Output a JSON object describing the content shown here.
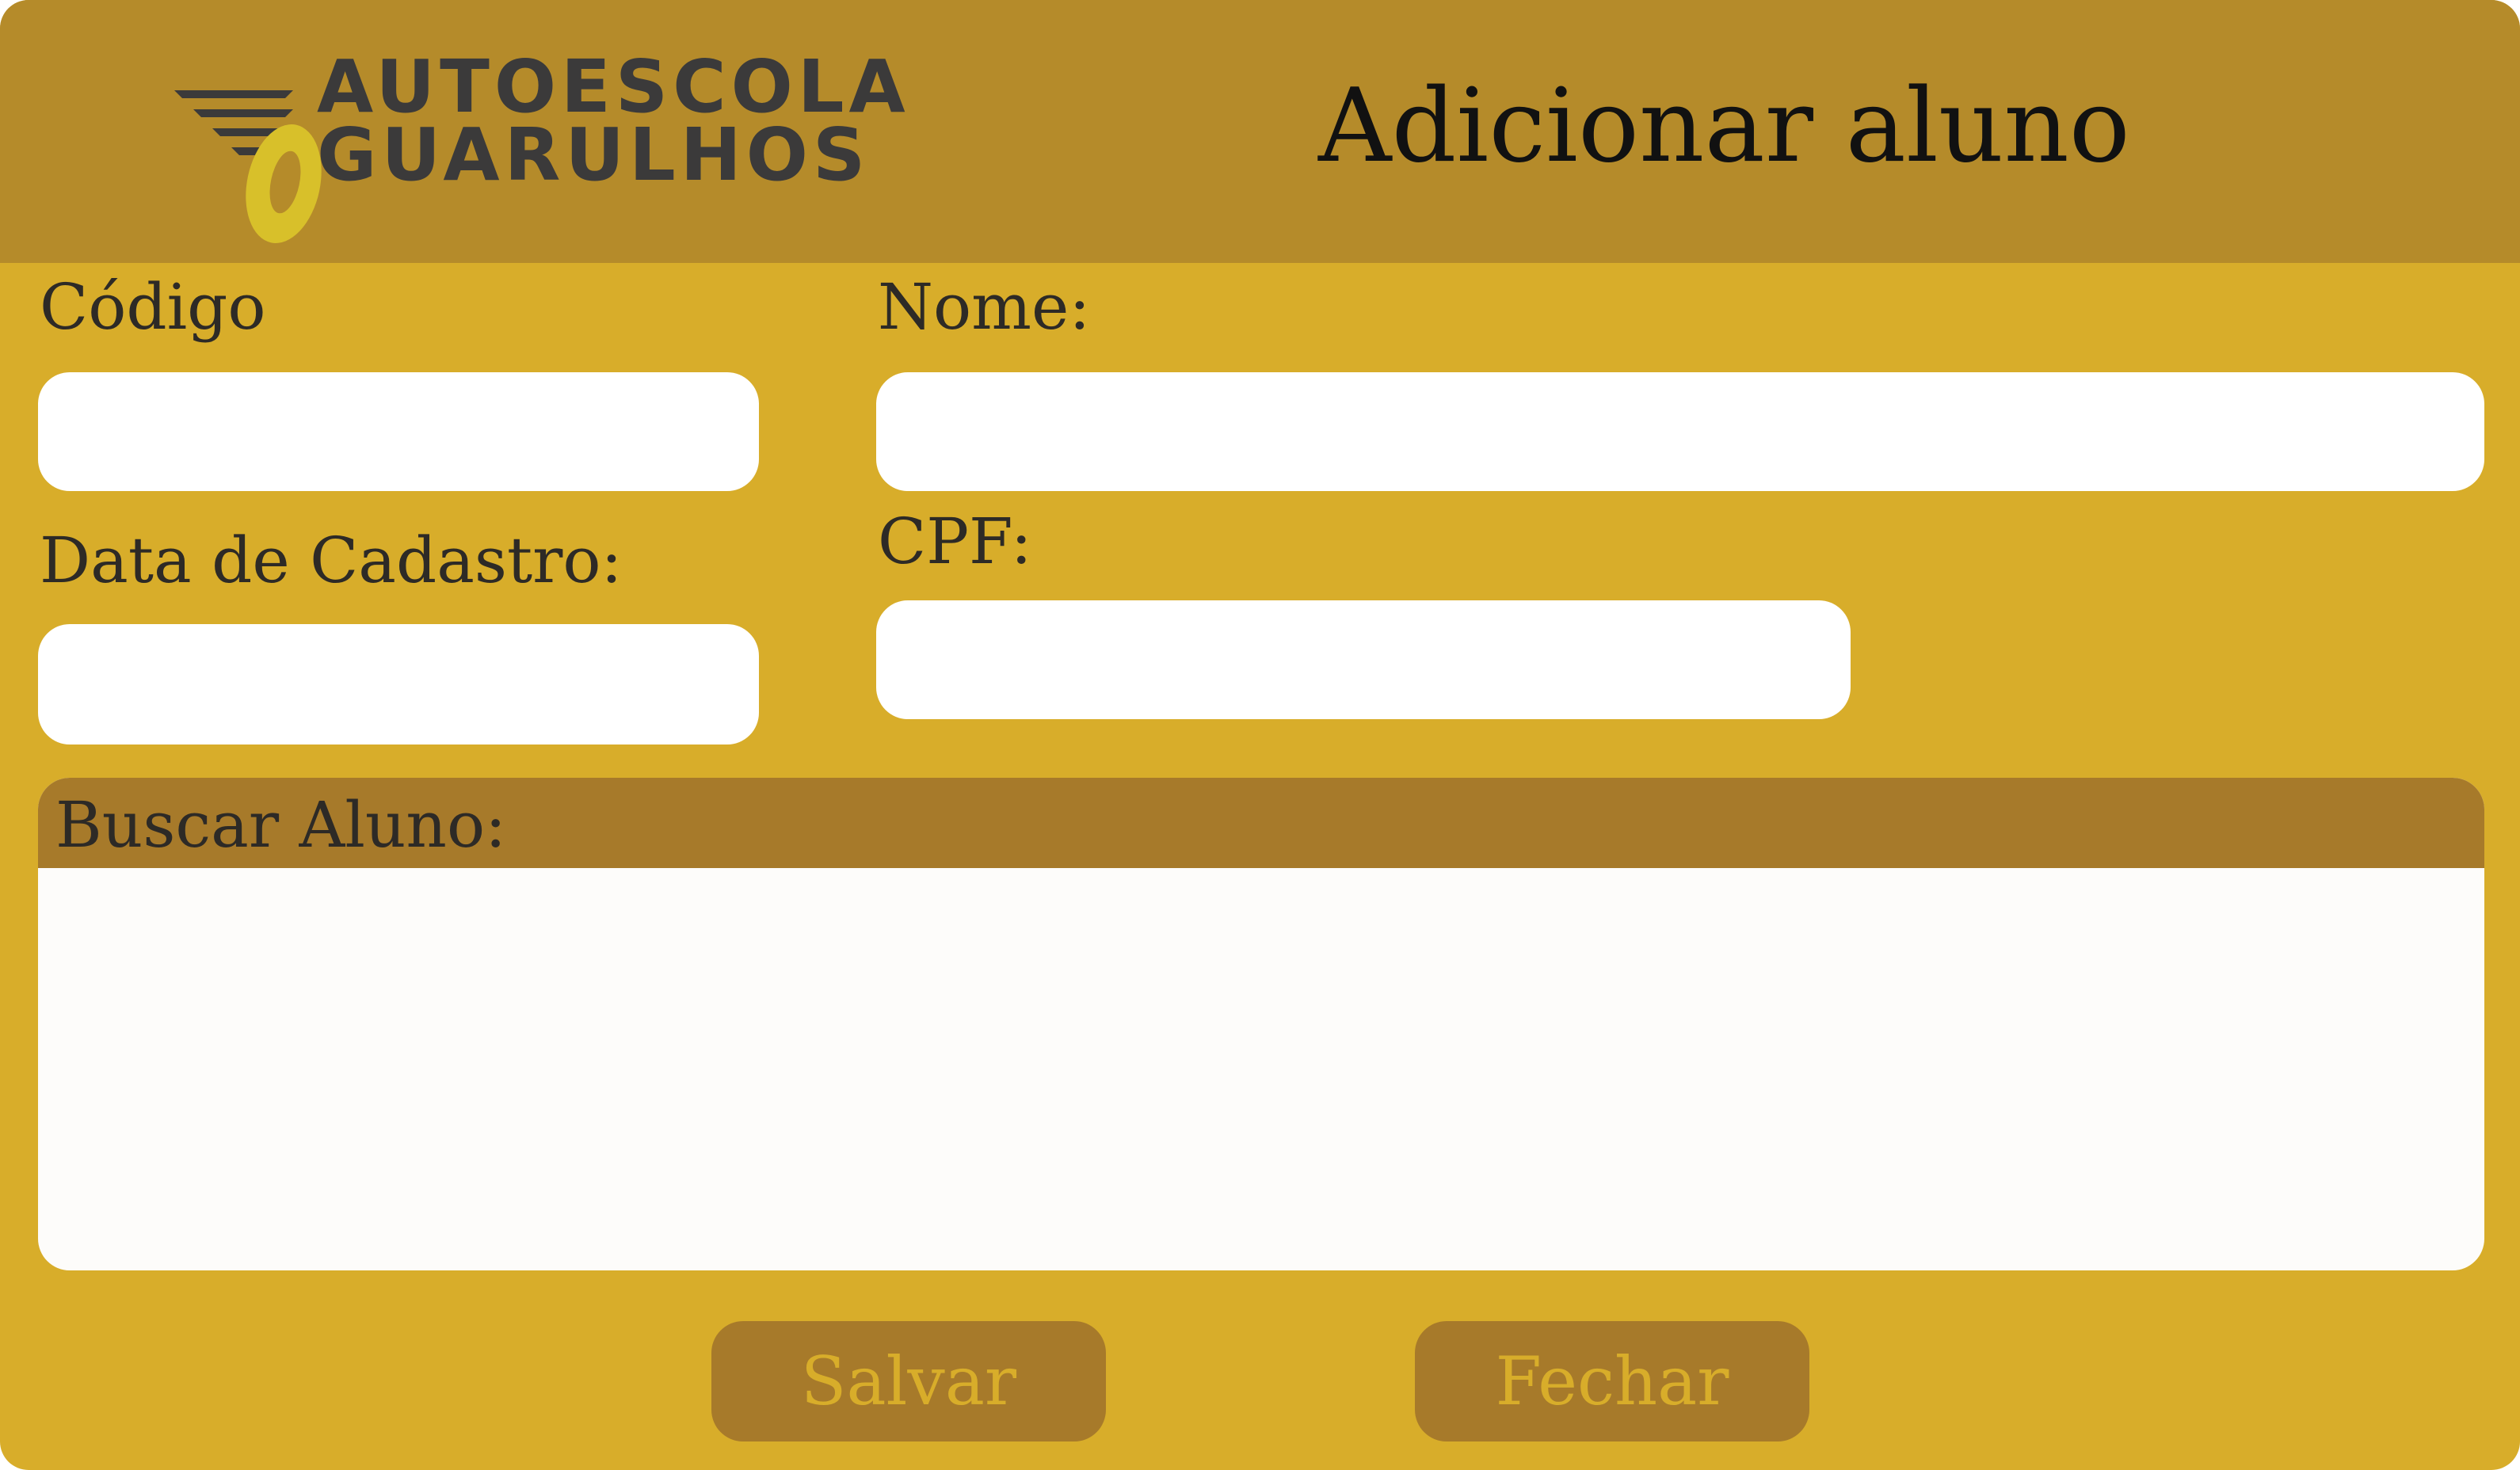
{
  "colors": {
    "window_background": "#D8AD2A",
    "header_background": "#B58B2A",
    "panel_header_background": "#A77A2A",
    "button_background": "#A77A2A",
    "button_text": "#D8AD2A",
    "input_background": "#FFFFFF",
    "logo_text": "#3B3A3A",
    "logo_wheel": "#D8C02A"
  },
  "header": {
    "logo": {
      "line1": "AUTOESCOLA",
      "line2": "GUARULHOS",
      "icon": "wheel-speed-icon"
    },
    "title": "Adicionar aluno"
  },
  "form": {
    "codigo": {
      "label": "Código",
      "value": ""
    },
    "nome": {
      "label": "Nome:",
      "value": ""
    },
    "data_cadastro": {
      "label": "Data de Cadastro:",
      "value": ""
    },
    "cpf": {
      "label": "CPF:",
      "value": ""
    }
  },
  "search": {
    "title": "Buscar Aluno:",
    "results": []
  },
  "actions": {
    "save_label": "Salvar",
    "close_label": "Fechar"
  }
}
